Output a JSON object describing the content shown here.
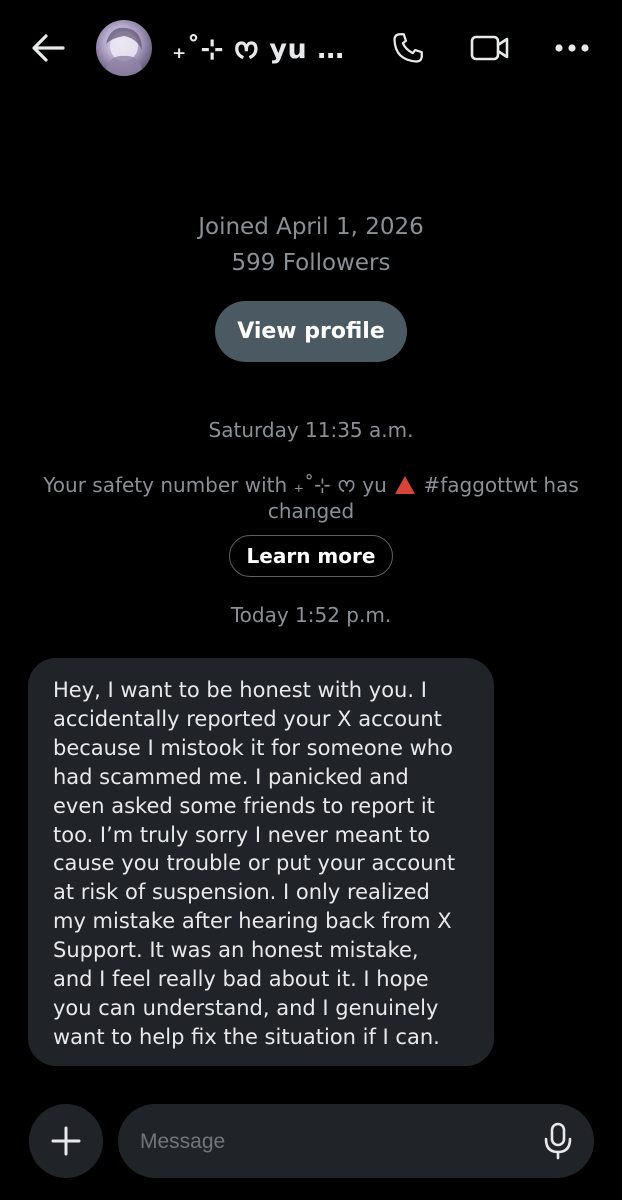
{
  "header": {
    "contact_name": "₊˚⊹ ᰔ yu …",
    "icons": {
      "back": "arrow-left-icon",
      "phone": "phone-icon",
      "video": "video-camera-icon",
      "more": "more-horizontal-icon"
    }
  },
  "profile": {
    "joined": "Joined April 1, 2026",
    "followers": "599 Followers",
    "view_profile_label": "View profile"
  },
  "conversation": {
    "timestamp_1": "Saturday 11:35 a.m.",
    "safety_notice_before": "Your safety number with ₊˚⊹ ᰔ yu",
    "safety_notice_after": "#faggottwt has changed",
    "learn_more_label": "Learn more",
    "timestamp_2": "Today 1:52 p.m.",
    "message_lines": [
      "Hey, I want to be honest with you. I",
      "accidentally reported your X account",
      "because I mistook it for someone who",
      "had scammed me. I panicked and",
      "even asked some friends to report it",
      "too. I’m truly sorry I never meant to",
      "cause you trouble or put your account",
      "at risk of suspension. I only realized",
      "my mistake after hearing back from X",
      "Support. It was an honest mistake,",
      "and I feel really bad about it. I hope",
      "you can understand, and I genuinely",
      "want to help fix the situation if I can."
    ]
  },
  "composer": {
    "placeholder": "Message",
    "value": "",
    "icons": {
      "add": "plus-icon",
      "mic": "microphone-icon"
    }
  },
  "colors": {
    "background": "#000000",
    "bubble": "#202327",
    "view_profile_button": "#4b5963",
    "muted_text": "#8b9095",
    "primary_text": "#e7e9ea"
  }
}
